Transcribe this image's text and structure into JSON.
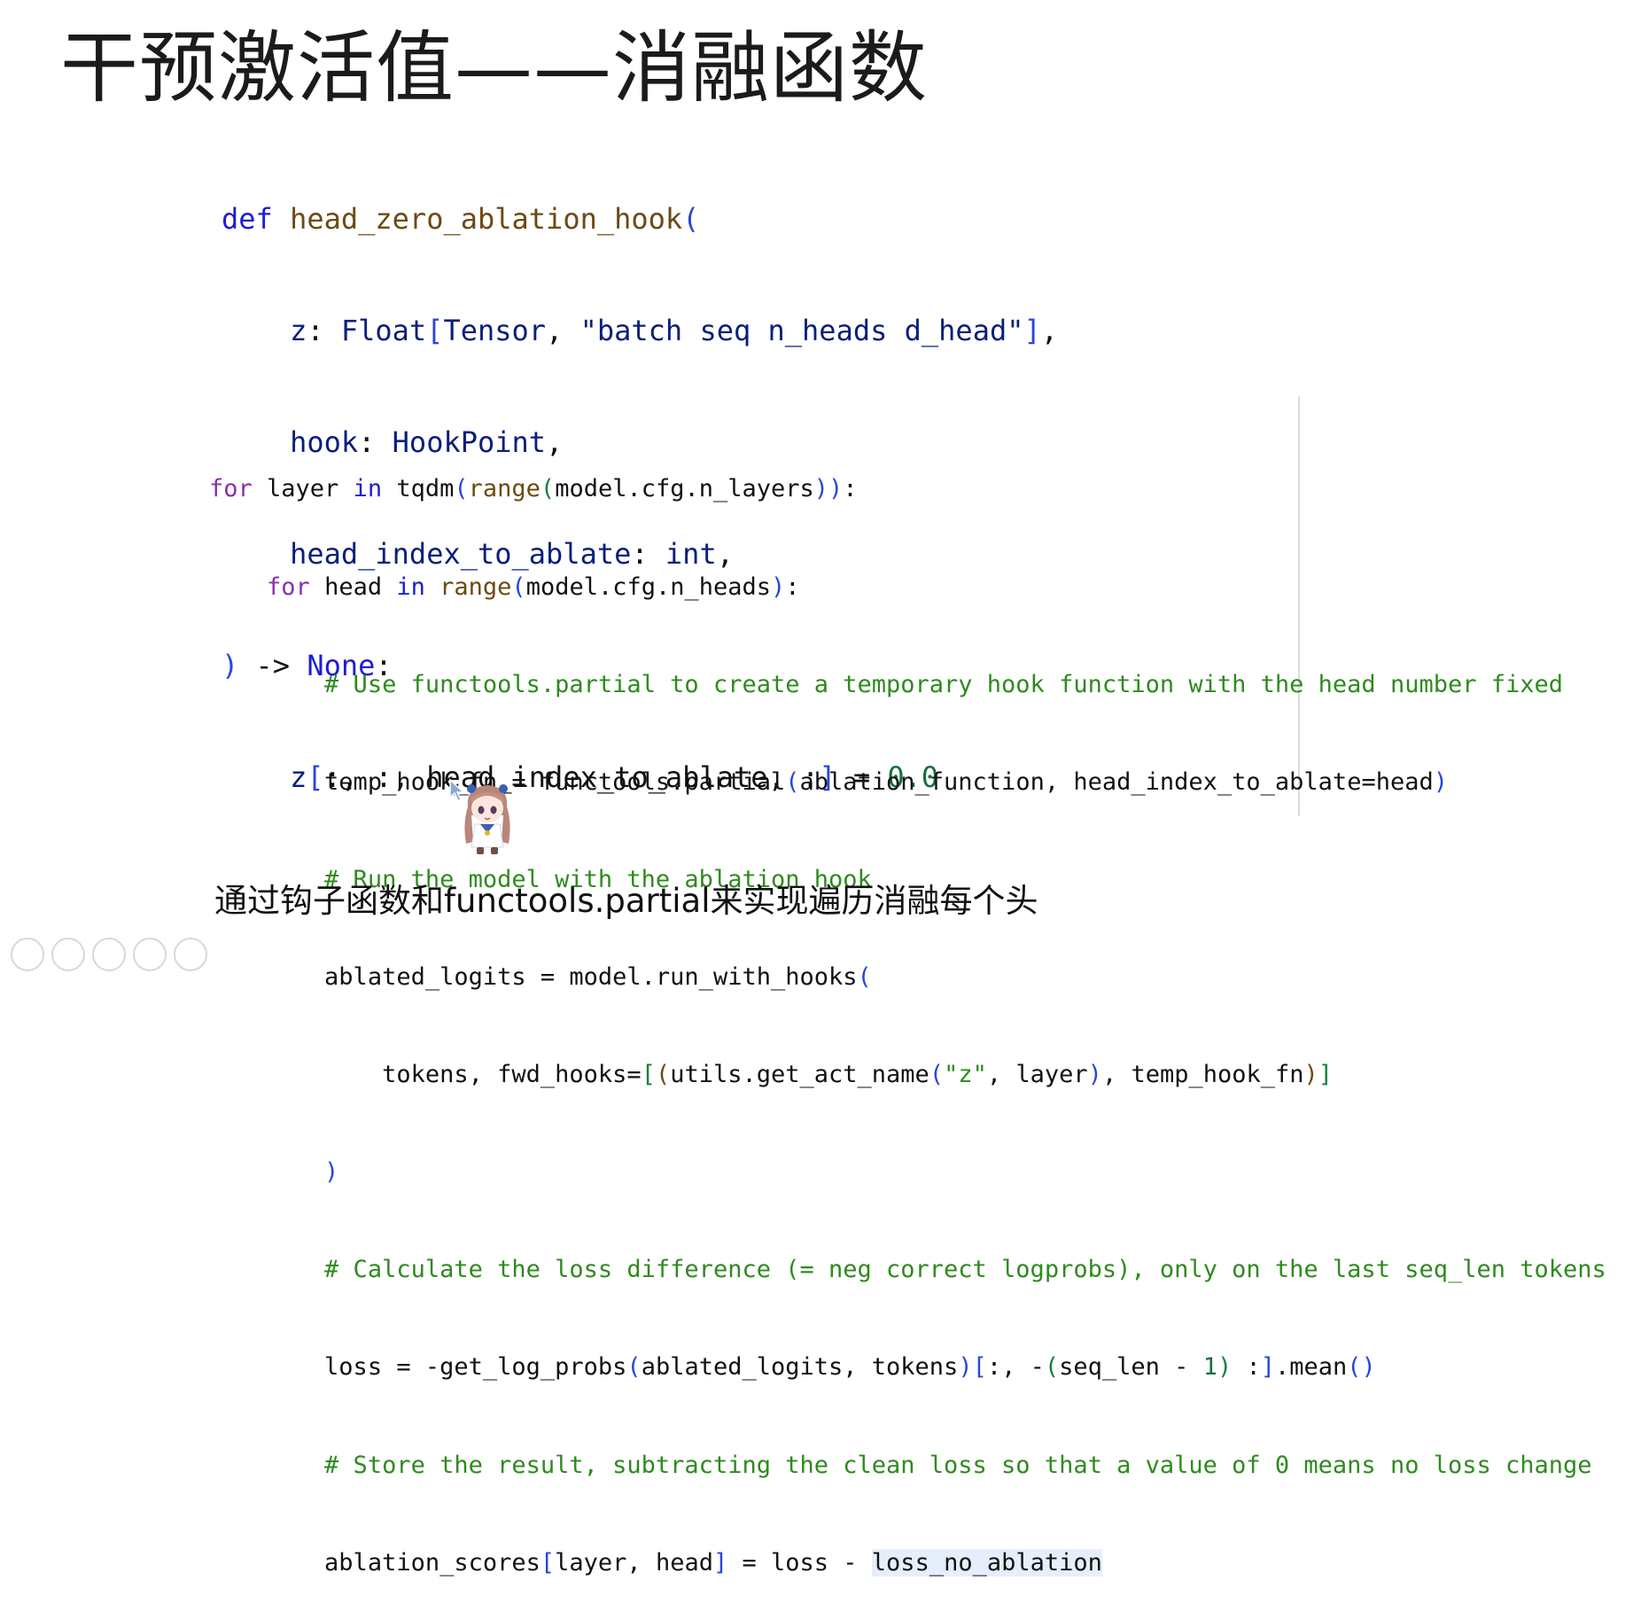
{
  "slide": {
    "title": "干预激活值——消融函数",
    "caption": "通过钩子函数和functools.partial来实现遍历消融每个头"
  },
  "code_block_1": {
    "def_kw": "def",
    "fn_name": "head_zero_ablation_hook",
    "paren_open": "(",
    "arg1_name": "z",
    "arg1_colon": ": ",
    "arg1_type": "Float",
    "arg1_br_open": "[",
    "arg1_tensor": "Tensor",
    "arg1_comma": ", ",
    "arg1_str": "\"batch seq n_heads d_head\"",
    "arg1_br_close": "]",
    "arg1_end": ",",
    "arg2_name": "hook",
    "arg2_colon": ": ",
    "arg2_type": "HookPoint",
    "arg2_end": ",",
    "arg3_name": "head_index_to_ablate",
    "arg3_colon": ": ",
    "arg3_type": "int",
    "arg3_end": ",",
    "close_paren": ")",
    "arrow": " -> ",
    "ret_type": "None",
    "ret_colon": ":",
    "body_z": "z",
    "body_br_open": "[",
    "body_idx": ":, :, head_index_to_ablate, :",
    "body_br_close": "]",
    "body_eq": " = ",
    "body_val": "0.0"
  },
  "code_block_2": {
    "l1_for": "for",
    "l1_a": " layer ",
    "l1_in": "in",
    "l1_b": " tqdm",
    "l1_p1": "(",
    "l1_range": "range",
    "l1_p2": "(",
    "l1_c": "model.cfg.n_layers",
    "l1_p3": "))",
    "l1_colon": ":",
    "l2_for": "for",
    "l2_a": " head ",
    "l2_in": "in",
    "l2_range": " range",
    "l2_p1": "(",
    "l2_b": "model.cfg.n_heads",
    "l2_p2": ")",
    "l2_colon": ":",
    "l3_comment": "# Use functools.partial to create a temporary hook function with the head number fixed",
    "l4_a": "temp_hook_fn = functools.partial",
    "l4_p1": "(",
    "l4_b": "ablation_function, head_index_to_ablate=head",
    "l4_p2": ")",
    "l5_comment": "# Run the model with the ablation hook",
    "l6_a": "ablated_logits = model.run_with_hooks",
    "l6_p1": "(",
    "l7_a": "tokens, fwd_hooks=",
    "l7_b1": "[",
    "l7_b2": "(",
    "l7_b": "utils.get_act_name",
    "l7_b3": "(",
    "l7_str": "\"z\"",
    "l7_c": ", layer",
    "l7_b4": ")",
    "l7_d": ", temp_hook_fn",
    "l7_b5": ")",
    "l7_b6": "]",
    "l8_close": ")",
    "l9_comment": "# Calculate the loss difference (= neg correct logprobs), only on the last seq_len tokens",
    "l10_a": "loss = -get_log_probs",
    "l10_p1": "(",
    "l10_b": "ablated_logits, tokens",
    "l10_p2": ")",
    "l10_br1": "[",
    "l10_c": ":, -",
    "l10_p3": "(",
    "l10_d": "seq_len - ",
    "l10_num": "1",
    "l10_p4": ")",
    "l10_e": " :",
    "l10_br2": "]",
    "l10_f": ".mean",
    "l10_p5": "()",
    "l11_comment": "# Store the result, subtracting the clean loss so that a value of 0 means no loss change",
    "l12_a": "ablation_scores",
    "l12_br1": "[",
    "l12_b": "layer, head",
    "l12_br2": "]",
    "l12_c": " = loss - ",
    "l12_hl": "loss_no_ablation"
  },
  "icons": [
    "cursor-arrow-icon",
    "anime-mascot-icon",
    "play-icon",
    "pen-icon",
    "copy-icon",
    "zoom-icon",
    "more-icon"
  ]
}
